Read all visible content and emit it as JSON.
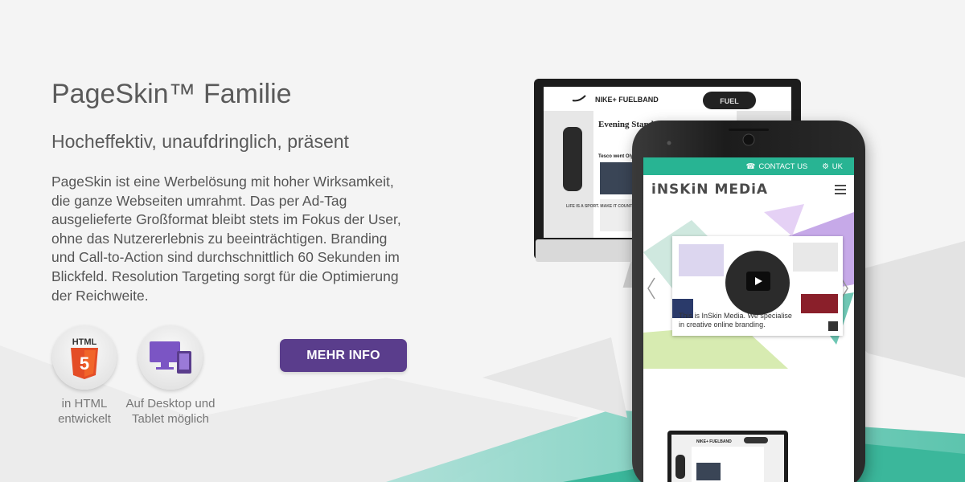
{
  "heading": {
    "title": "PageSkin™ Familie",
    "subtitle": "Hocheffektiv, unaufdringlich, präsent"
  },
  "description": "PageSkin ist eine Werbelösung mit hoher Wirksamkeit, die ganze Webseiten umrahmt. Das per Ad-Tag ausgelieferte Großformat bleibt stets im Fokus der User, ohne das Nutzererlebnis zu beeinträchtigen. Branding und Call-to-Action sind durchschnittlich 60 Sekunden im Blickfeld. Resolution Targeting sorgt für die Optimierung der Reichweite.",
  "features": [
    {
      "icon": "html5-icon",
      "badge": "HTML",
      "label": "in HTML entwickelt"
    },
    {
      "icon": "desktop-tablet-icon",
      "label": "Auf Desktop und Tablet möglich"
    }
  ],
  "cta_label": "MEHR INFO",
  "monitor_screen": {
    "nike_header": "NIKE+ FUELBAND",
    "fuel_label": "FUEL",
    "newspaper_name": "Evening Standard",
    "headline": "Tesco went Olympic to test",
    "side_text": "LIFE IS A SPORT. MAKE IT COUNT."
  },
  "phone_screen": {
    "contact_label": "CONTACT US",
    "region_label": "UK",
    "brand_logo": "iNSKiN MEDiA",
    "video_caption": "This is InSkin Media. We specialise in creative online branding.",
    "mini_nike_label": "NIKE+ FUELBAND"
  },
  "colors": {
    "accent_purple": "#5a3d8c",
    "accent_green": "#28b493",
    "html5_orange": "#e44d26",
    "device_purple": "#7b55c4"
  }
}
